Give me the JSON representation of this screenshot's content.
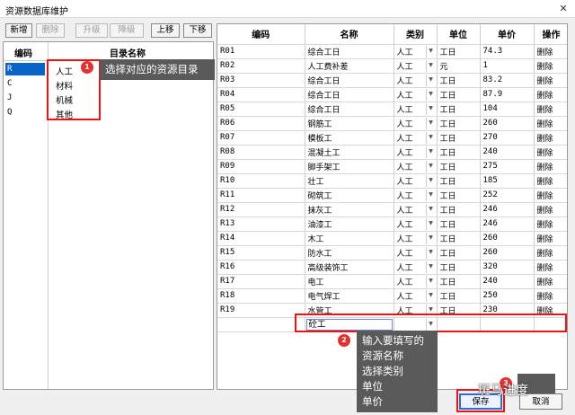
{
  "window": {
    "title": "资源数据库维护",
    "close_glyph": "✕"
  },
  "toolbar": {
    "add": "新增",
    "delete": "删除",
    "upgrade": "升级",
    "downgrade": "降级",
    "move_up": "上移",
    "move_down": "下移"
  },
  "left": {
    "headers": {
      "code": "编码",
      "name": "目录名称"
    },
    "rows": [
      {
        "code": "R",
        "name": "人工",
        "selected": true
      },
      {
        "code": "C",
        "name": "材料"
      },
      {
        "code": "J",
        "name": "机械"
      },
      {
        "code": "Q",
        "name": "其他"
      }
    ]
  },
  "grid": {
    "headers": [
      "编码",
      "名称",
      "类别",
      "单位",
      "单价",
      "操作"
    ],
    "rows": [
      {
        "code": "R01",
        "name": "综合工日",
        "cat": "人工",
        "unit": "工日",
        "price": "74.3",
        "op": "删除"
      },
      {
        "code": "R02",
        "name": "人工费补差",
        "cat": "人工",
        "unit": "元",
        "price": "1",
        "op": "删除"
      },
      {
        "code": "R03",
        "name": "综合工日",
        "cat": "人工",
        "unit": "工日",
        "price": "83.2",
        "op": "删除"
      },
      {
        "code": "R04",
        "name": "综合工日",
        "cat": "人工",
        "unit": "工日",
        "price": "87.9",
        "op": "删除"
      },
      {
        "code": "R05",
        "name": "综合工日",
        "cat": "人工",
        "unit": "工日",
        "price": "104",
        "op": "删除"
      },
      {
        "code": "R06",
        "name": "钢筋工",
        "cat": "人工",
        "unit": "工日",
        "price": "260",
        "op": "删除"
      },
      {
        "code": "R07",
        "name": "模板工",
        "cat": "人工",
        "unit": "工日",
        "price": "270",
        "op": "删除"
      },
      {
        "code": "R08",
        "name": "混凝土工",
        "cat": "人工",
        "unit": "工日",
        "price": "240",
        "op": "删除"
      },
      {
        "code": "R09",
        "name": "脚手架工",
        "cat": "人工",
        "unit": "工日",
        "price": "275",
        "op": "删除"
      },
      {
        "code": "R10",
        "name": "壮工",
        "cat": "人工",
        "unit": "工日",
        "price": "185",
        "op": "删除"
      },
      {
        "code": "R11",
        "name": "砌筑工",
        "cat": "人工",
        "unit": "工日",
        "price": "252",
        "op": "删除"
      },
      {
        "code": "R12",
        "name": "抹灰工",
        "cat": "人工",
        "unit": "工日",
        "price": "246",
        "op": "删除"
      },
      {
        "code": "R13",
        "name": "油漆工",
        "cat": "人工",
        "unit": "工日",
        "price": "246",
        "op": "删除"
      },
      {
        "code": "R14",
        "name": "木工",
        "cat": "人工",
        "unit": "工日",
        "price": "260",
        "op": "删除"
      },
      {
        "code": "R15",
        "name": "防水工",
        "cat": "人工",
        "unit": "工日",
        "price": "260",
        "op": "删除"
      },
      {
        "code": "R16",
        "name": "高级装饰工",
        "cat": "人工",
        "unit": "工日",
        "price": "320",
        "op": "删除"
      },
      {
        "code": "R17",
        "name": "电工",
        "cat": "人工",
        "unit": "工日",
        "price": "240",
        "op": "删除"
      },
      {
        "code": "R18",
        "name": "电气焊工",
        "cat": "人工",
        "unit": "工日",
        "price": "250",
        "op": "删除"
      },
      {
        "code": "R19",
        "name": "水管工",
        "cat": "人工",
        "unit": "工日",
        "price": "230",
        "op": "删除"
      }
    ],
    "new_row": {
      "name_value": "砼工"
    }
  },
  "callouts": {
    "one": {
      "num": "1",
      "text": "选择对应的资源目录"
    },
    "two": {
      "num": "2",
      "lines": [
        "输入要填写的",
        "资源名称",
        "选择类别",
        "单位",
        "单价"
      ]
    },
    "three": {
      "num": "3"
    }
  },
  "buttons": {
    "save": "保存",
    "cancel": "取消"
  },
  "watermark": "斑马进度",
  "colors": {
    "highlight": "#e11111",
    "badge": "#e53030",
    "tooltip_bg": "#5a5a5a",
    "selection": "#0a64c8"
  }
}
